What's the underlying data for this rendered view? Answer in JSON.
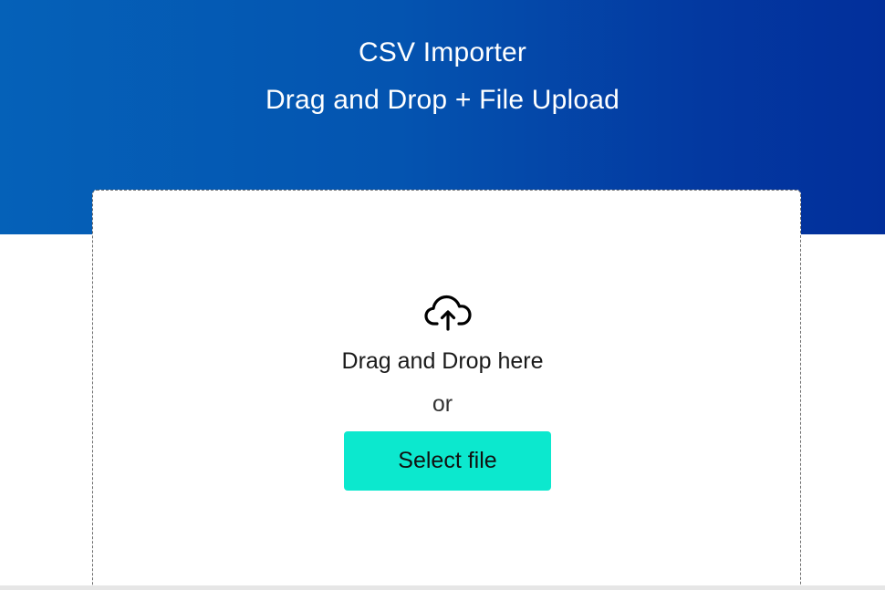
{
  "header": {
    "title": "CSV Importer",
    "subtitle": "Drag and Drop + File Upload",
    "gradient_start": "#0561b8",
    "gradient_end": "#022f9b"
  },
  "dropzone": {
    "icon": "cloud-upload-icon",
    "prompt": "Drag and Drop here",
    "separator": "or",
    "button_label": "Select file",
    "button_color": "#0ce8ce"
  }
}
